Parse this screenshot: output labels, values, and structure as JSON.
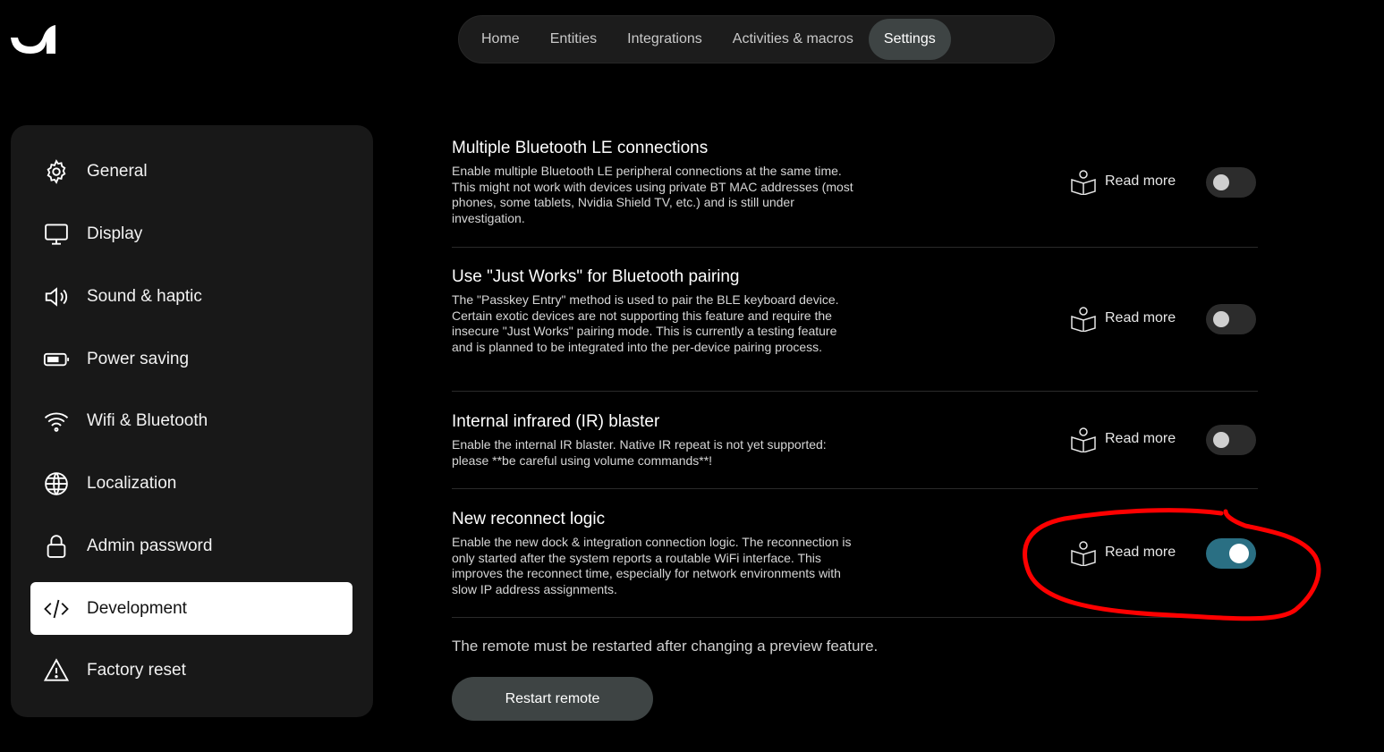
{
  "logo": {
    "icon": "unfolded-circle-logo-icon"
  },
  "topnav": {
    "tabs": [
      {
        "label": "Home",
        "active": false
      },
      {
        "label": "Entities",
        "active": false
      },
      {
        "label": "Integrations",
        "active": false
      },
      {
        "label": "Activities & macros",
        "active": false
      },
      {
        "label": "Settings",
        "active": true
      }
    ]
  },
  "sidebar": {
    "items": [
      {
        "label": "General",
        "icon": "gear-icon",
        "active": false
      },
      {
        "label": "Display",
        "icon": "monitor-icon",
        "active": false
      },
      {
        "label": "Sound & haptic",
        "icon": "speaker-icon",
        "active": false
      },
      {
        "label": "Power saving",
        "icon": "battery-icon",
        "active": false
      },
      {
        "label": "Wifi & Bluetooth",
        "icon": "wifi-icon",
        "active": false
      },
      {
        "label": "Localization",
        "icon": "globe-icon",
        "active": false
      },
      {
        "label": "Admin password",
        "icon": "lock-icon",
        "active": false
      },
      {
        "label": "Development",
        "icon": "code-icon",
        "active": true
      },
      {
        "label": "Factory reset",
        "icon": "warning-icon",
        "active": false
      }
    ]
  },
  "settings": [
    {
      "title": "Multiple Bluetooth LE connections",
      "description": "Enable multiple Bluetooth LE peripheral connections at the same time. This might not work with devices using private BT MAC addresses (most phones, some tablets, Nvidia Shield TV, etc.) and is still under investigation.",
      "read_more": "Read more",
      "enabled": false
    },
    {
      "title": "Use \"Just Works\" for Bluetooth pairing",
      "description": "The \"Passkey Entry\" method is used to pair the BLE keyboard device. Certain exotic devices are not supporting this feature and require the insecure \"Just Works\" pairing mode. This is currently a testing feature and is planned to be integrated into the per-device pairing process.",
      "read_more": "Read more",
      "enabled": false
    },
    {
      "title": "Internal infrared (IR) blaster",
      "description": "Enable the internal IR blaster. Native IR repeat is not yet supported: please **be careful using volume commands**!",
      "read_more": "Read more",
      "enabled": false
    },
    {
      "title": "New reconnect logic",
      "description": "Enable the new dock & integration connection logic. The reconnection is only started after the system reports a routable WiFi interface. This improves the reconnect time, especially for network environments with slow IP address assignments.",
      "read_more": "Read more",
      "enabled": true
    }
  ],
  "note": "The remote must be restarted after changing a preview feature.",
  "restart_button": "Restart remote",
  "colors": {
    "background": "#000000",
    "sidebar": "#181818",
    "toggle_on": "#2a6f83",
    "annotation": "#ff0000"
  }
}
